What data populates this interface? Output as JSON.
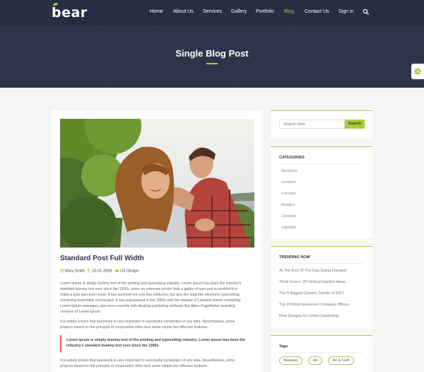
{
  "header": {
    "logo": "bear",
    "nav": [
      {
        "label": "Home"
      },
      {
        "label": "About Us"
      },
      {
        "label": "Services"
      },
      {
        "label": "Gallery"
      },
      {
        "label": "Portfolio"
      },
      {
        "label": "Blog",
        "active": true
      },
      {
        "label": "Contact Us"
      },
      {
        "label": "Sign in"
      }
    ],
    "search_icon": "search-icon"
  },
  "hero": {
    "title": "Single Blog Post"
  },
  "post": {
    "title": "Standard Post Full Width",
    "author": "Mary Smith",
    "date": "10-01-2018",
    "category": "UX Design",
    "paragraph1": "Lorem Ipsum is simply dummy text of the printing and typesetting industry. Lorem Ipsum has been the industry's standard dummy text ever since the 1500s, when an unknown printer took a galley of type and scrambled it to make a type specimen book. It has survived not only five centuries, but also the leap into electronic typesetting, remaining essentially unchanged. It was popularised in the 1960s with the release of Letraset sheets containing Lorem Ipsum passages, and more recently with desktop publishing software like Aldus PageMaker including versions of Lorem Ipsum.",
    "paragraph2": "It is widely known that teamwork is very important to successful completion of any idea. Nevertheless, some projects based on the principle of cooperation often lack some simple but effective features.",
    "quote": "Lorem Ipsum is simply dummy text of the printing and typesetting industry. Lorem Ipsum has been the industry's standard dummy text ever since the 1500s",
    "paragraph3": "It is widely known that teamwork is very important to successful completion of any idea. Nevertheless, some projects based on the principle of cooperation often lack some simple but effective features."
  },
  "sidebar": {
    "search": {
      "placeholder": "Search Here",
      "button": "Search"
    },
    "categories": {
      "title": "CATEGORIES",
      "items": [
        "- Business",
        "- Creative",
        "- Lifestyle",
        "- Aviation",
        "- Creative",
        "- Lifestyle"
      ]
    },
    "trending": {
      "title": "TRENDING NOW",
      "items": [
        "At The End Of The Day Going Forward",
        "Think Green: 20 Vertical Garden Ideas",
        "The 5 Biggest Garden Trends of 2017",
        "Top 20 Most Awesome Company Offices",
        "Best Designs for Urban Gardening"
      ]
    },
    "tags": {
      "title": "Tags",
      "items": [
        "Business",
        "Art",
        "Art & Craft"
      ]
    }
  },
  "colors": {
    "nav_bg": "#262e42",
    "accent": "#a6ce39",
    "quote_bar": "#e2574c"
  }
}
